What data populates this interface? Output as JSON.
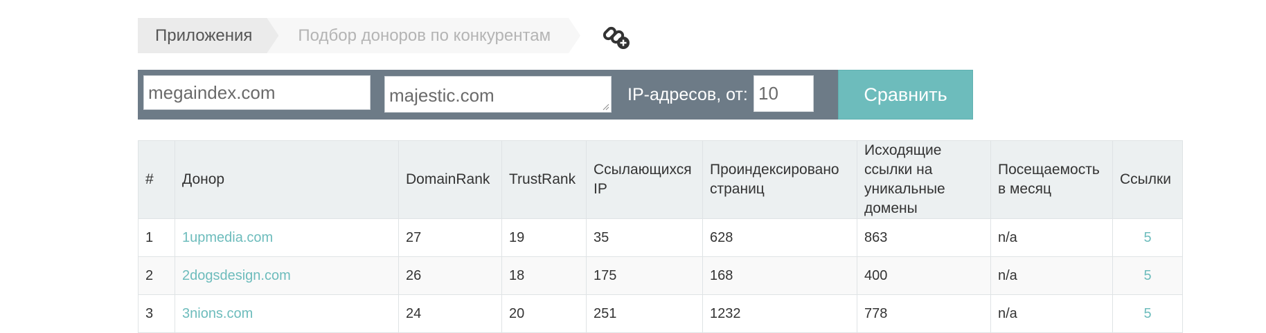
{
  "breadcrumb": {
    "items": [
      "Приложения",
      "Подбор доноров по конкурентам"
    ]
  },
  "icons": {
    "add_link": "link-add-icon"
  },
  "toolbar": {
    "domain_value": "megaindex.com",
    "compare_value": "majestic.com",
    "ip_label": "IP-адресов, от:",
    "ip_value": "10",
    "compare_button": "Сравнить"
  },
  "colors": {
    "toolbar_bg": "#6d7b87",
    "accent": "#6dbcbc",
    "header_bg": "#ecf0f1"
  },
  "table": {
    "headers": [
      "#",
      "Донор",
      "DomainRank",
      "TrustRank",
      "Ссылающихся IP",
      "Проиндексировано страниц",
      "Исходящие ссылки на уникальные домены",
      "Посещаемость в месяц",
      "Ссылки"
    ],
    "rows": [
      {
        "num": "1",
        "donor": "1upmedia.com",
        "domain_rank": "27",
        "trust_rank": "19",
        "ips": "35",
        "indexed": "628",
        "outbound": "863",
        "traffic": "n/a",
        "links": "5"
      },
      {
        "num": "2",
        "donor": "2dogsdesign.com",
        "domain_rank": "26",
        "trust_rank": "18",
        "ips": "175",
        "indexed": "168",
        "outbound": "400",
        "traffic": "n/a",
        "links": "5"
      },
      {
        "num": "3",
        "donor": "3nions.com",
        "domain_rank": "24",
        "trust_rank": "20",
        "ips": "251",
        "indexed": "1232",
        "outbound": "778",
        "traffic": "n/a",
        "links": "5"
      }
    ]
  }
}
